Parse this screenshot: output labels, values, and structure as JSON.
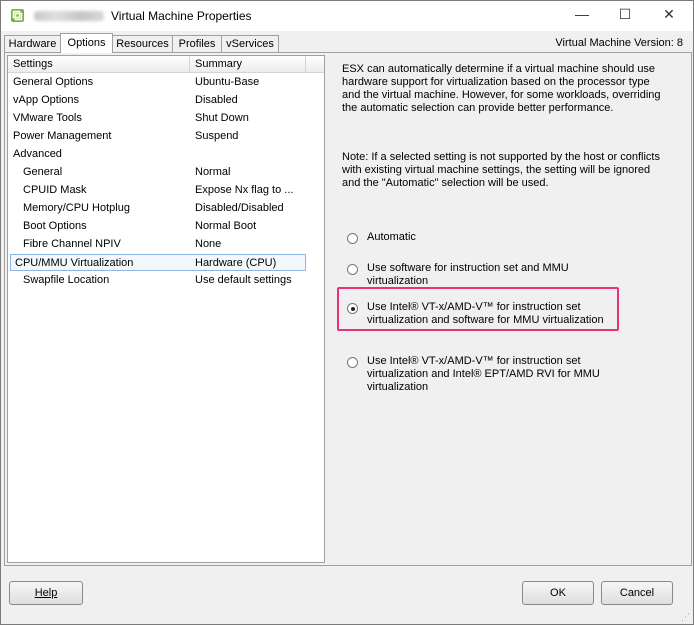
{
  "window": {
    "title": "Virtual Machine Properties",
    "icon": "vmware-app-icon",
    "controls": {
      "minimize": "—",
      "maximize": "☐",
      "close": "✕"
    }
  },
  "tabs": [
    {
      "label": "Hardware",
      "active": false
    },
    {
      "label": "Options",
      "active": true
    },
    {
      "label": "Resources",
      "active": false
    },
    {
      "label": "Profiles",
      "active": false
    },
    {
      "label": "vServices",
      "active": false
    }
  ],
  "vm_version": "Virtual Machine Version: 8",
  "settings": {
    "header": {
      "settings": "Settings",
      "summary": "Summary"
    },
    "rows": [
      {
        "name": "General Options",
        "summary": "Ubuntu-Base"
      },
      {
        "name": "vApp Options",
        "summary": "Disabled"
      },
      {
        "name": "VMware Tools",
        "summary": "Shut Down"
      },
      {
        "name": "Power Management",
        "summary": "Suspend"
      },
      {
        "name": "Advanced",
        "summary": ""
      },
      {
        "name": "General",
        "summary": "Normal"
      },
      {
        "name": "CPUID Mask",
        "summary": "Expose Nx flag to ..."
      },
      {
        "name": "Memory/CPU Hotplug",
        "summary": "Disabled/Disabled"
      },
      {
        "name": "Boot Options",
        "summary": "Normal Boot"
      },
      {
        "name": "Fibre Channel NPIV",
        "summary": "None"
      },
      {
        "name": "CPU/MMU Virtualization",
        "summary": "Hardware (CPU)"
      },
      {
        "name": "Swapfile Location",
        "summary": "Use default settings"
      }
    ]
  },
  "details": {
    "description": "ESX can automatically determine if a virtual machine should use hardware support for virtualization based on the processor type and the virtual machine. However, for some workloads, overriding the automatic selection can provide better performance.",
    "note": "Note: If a selected setting is not supported by the host or conflicts with existing virtual machine settings, the setting will be ignored and the \"Automatic\" selection will be used.",
    "options": [
      {
        "label": "Automatic",
        "checked": false
      },
      {
        "label": "Use software for instruction set and MMU virtualization",
        "checked": false
      },
      {
        "label": "Use Intel® VT-x/AMD-V™ for instruction set virtualization and software for MMU virtualization",
        "checked": true
      },
      {
        "label": "Use Intel® VT-x/AMD-V™ for instruction set virtualization and Intel® EPT/AMD RVI for MMU virtualization",
        "checked": false
      }
    ]
  },
  "buttons": {
    "help": "Help",
    "ok": "OK",
    "cancel": "Cancel"
  },
  "colors": {
    "highlight": "#e8337a",
    "selection_border": "#8fb6e1"
  }
}
